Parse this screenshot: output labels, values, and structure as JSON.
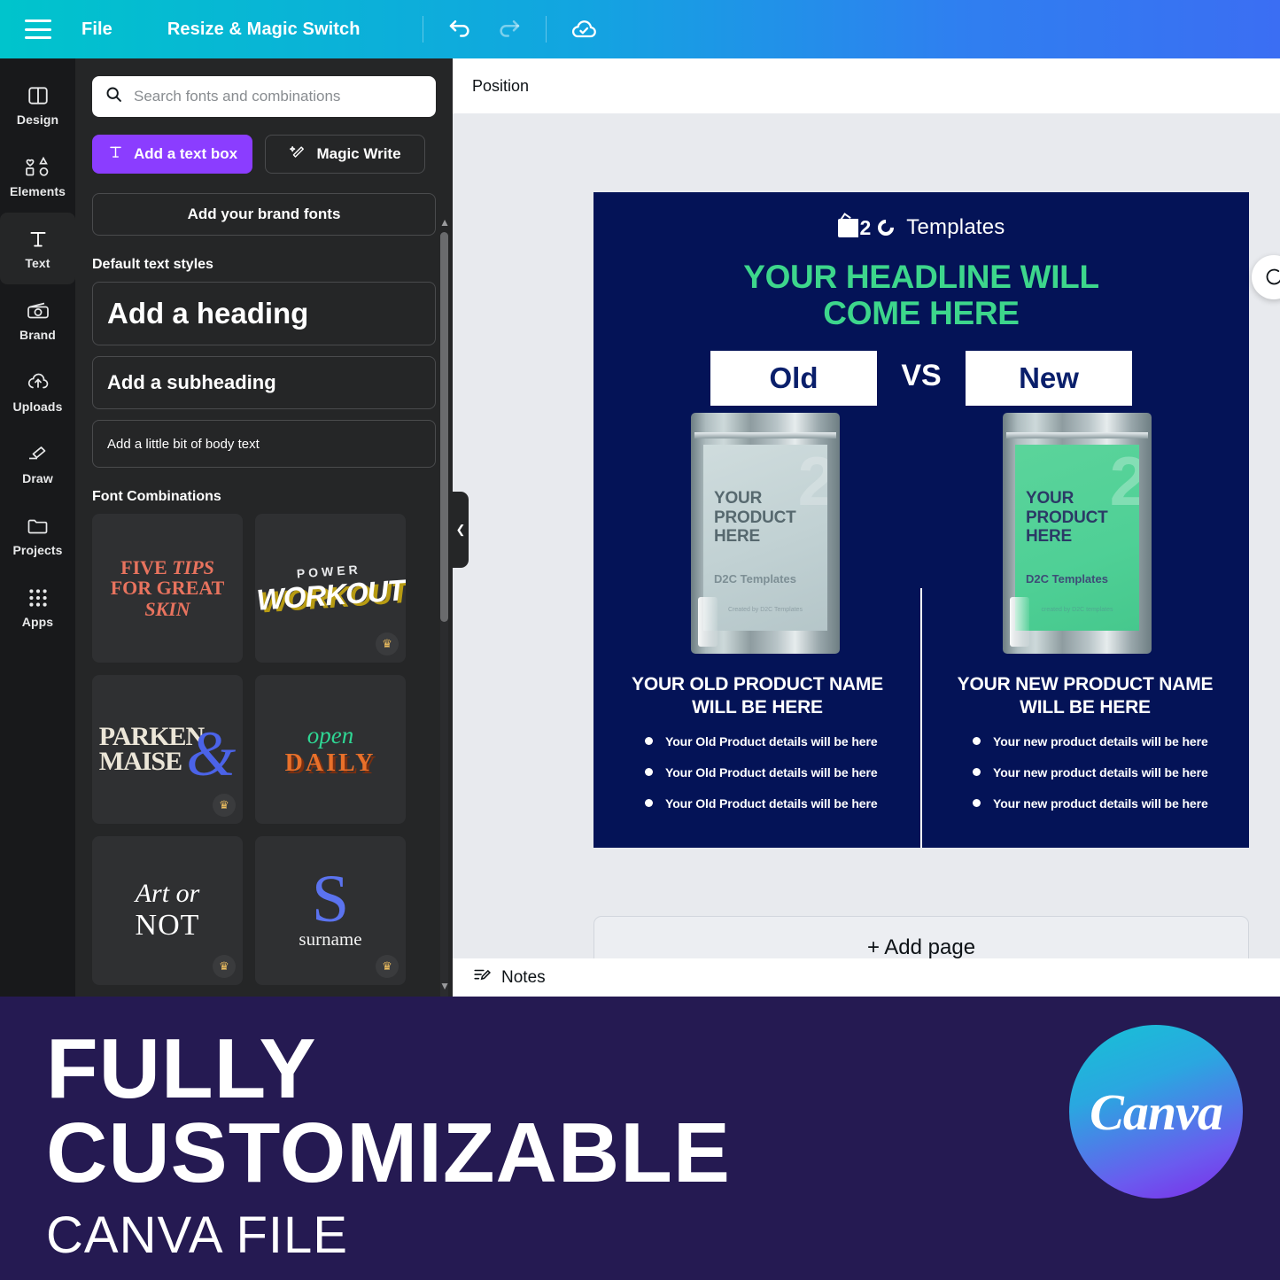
{
  "topbar": {
    "menu_icon": "hamburger-icon",
    "file_label": "File",
    "resize_label": "Resize & Magic Switch",
    "undo_icon": "undo-icon",
    "redo_icon": "redo-icon",
    "cloud_icon": "cloud-saved-icon"
  },
  "rail": {
    "items": [
      {
        "label": "Design",
        "icon": "design-icon"
      },
      {
        "label": "Elements",
        "icon": "elements-icon"
      },
      {
        "label": "Text",
        "icon": "text-icon"
      },
      {
        "label": "Brand",
        "icon": "brand-icon"
      },
      {
        "label": "Uploads",
        "icon": "uploads-icon"
      },
      {
        "label": "Draw",
        "icon": "draw-icon"
      },
      {
        "label": "Projects",
        "icon": "projects-icon"
      },
      {
        "label": "Apps",
        "icon": "apps-icon"
      }
    ],
    "active": "Text"
  },
  "panel": {
    "search": {
      "placeholder": "Search fonts and combinations",
      "value": "",
      "icon": "search-icon"
    },
    "add_text_box": "Add a text box",
    "magic_write": "Magic Write",
    "brand_fonts": "Add your brand fonts",
    "default_styles_title": "Default text styles",
    "styles": [
      "Add a heading",
      "Add a subheading",
      "Add a little bit of body text"
    ],
    "font_combinations_title": "Font Combinations",
    "combos": [
      {
        "name": "five-tips-for-great-skin",
        "lines": [
          "FIVE ",
          "TIPS",
          "FOR GREAT ",
          "SKIN"
        ],
        "pro": false
      },
      {
        "name": "power-workout",
        "top": "POWER",
        "bottom": "WORKOUT",
        "pro": true
      },
      {
        "name": "parken-maise",
        "l1": "PARKEN",
        "l2": "MAISE",
        "amp": "&",
        "pro": true
      },
      {
        "name": "open-daily",
        "l1": "open",
        "l2": "DAILY",
        "pro": false
      },
      {
        "name": "art-or-not",
        "l1": "Art or",
        "l2": "NOT",
        "pro": true
      },
      {
        "name": "surname",
        "letter": "S",
        "word": "surname",
        "pro": true
      }
    ],
    "collapse_icon": "chevron-left-icon"
  },
  "editor": {
    "position_label": "Position",
    "tools": [
      {
        "name": "lock-icon"
      },
      {
        "name": "duplicate-page-icon"
      },
      {
        "name": "add-page-icon"
      }
    ],
    "comment_button_icon": "comment-icon",
    "add_page_label": "+ Add page",
    "notes_label": "Notes",
    "notes_icon": "notes-icon"
  },
  "design": {
    "brand_name": "Templates",
    "brand_mark": "2",
    "headline_line1": "YOUR HEADLINE WILL",
    "headline_line2": "COME HERE",
    "chip_old": "Old",
    "chip_new": "New",
    "vs": "VS",
    "old": {
      "product_text": [
        "YOUR",
        "PRODUCT",
        "HERE"
      ],
      "pouch_logo": "D2C Templates",
      "pouch_note": "Created by D2C Templates",
      "name": "YOUR OLD PRODUCT NAME WILL BE HERE",
      "bullets": [
        "Your Old Product details will be here",
        "Your Old Product details will be here",
        "Your Old Product details will be here"
      ]
    },
    "new": {
      "product_text": [
        "YOUR",
        "PRODUCT",
        "HERE"
      ],
      "pouch_logo": "D2C Templates",
      "pouch_note": "created by D2C templates",
      "name": "YOUR NEW PRODUCT NAME WILL BE HERE",
      "bullets": [
        "Your new product details will be here",
        "Your new product details will be here",
        "Your new product details will be here"
      ]
    },
    "colors": {
      "background": "#041357",
      "headline": "#3dd68c",
      "chip_bg": "#ffffff",
      "chip_text": "#0a1f6b",
      "new_pouch": "#4fd096"
    }
  },
  "banner": {
    "line1": "FULLY",
    "line2": "CUSTOMIZABLE",
    "line3": "CANVA FILE",
    "badge_text": "Canva",
    "bg": "#251a52"
  }
}
